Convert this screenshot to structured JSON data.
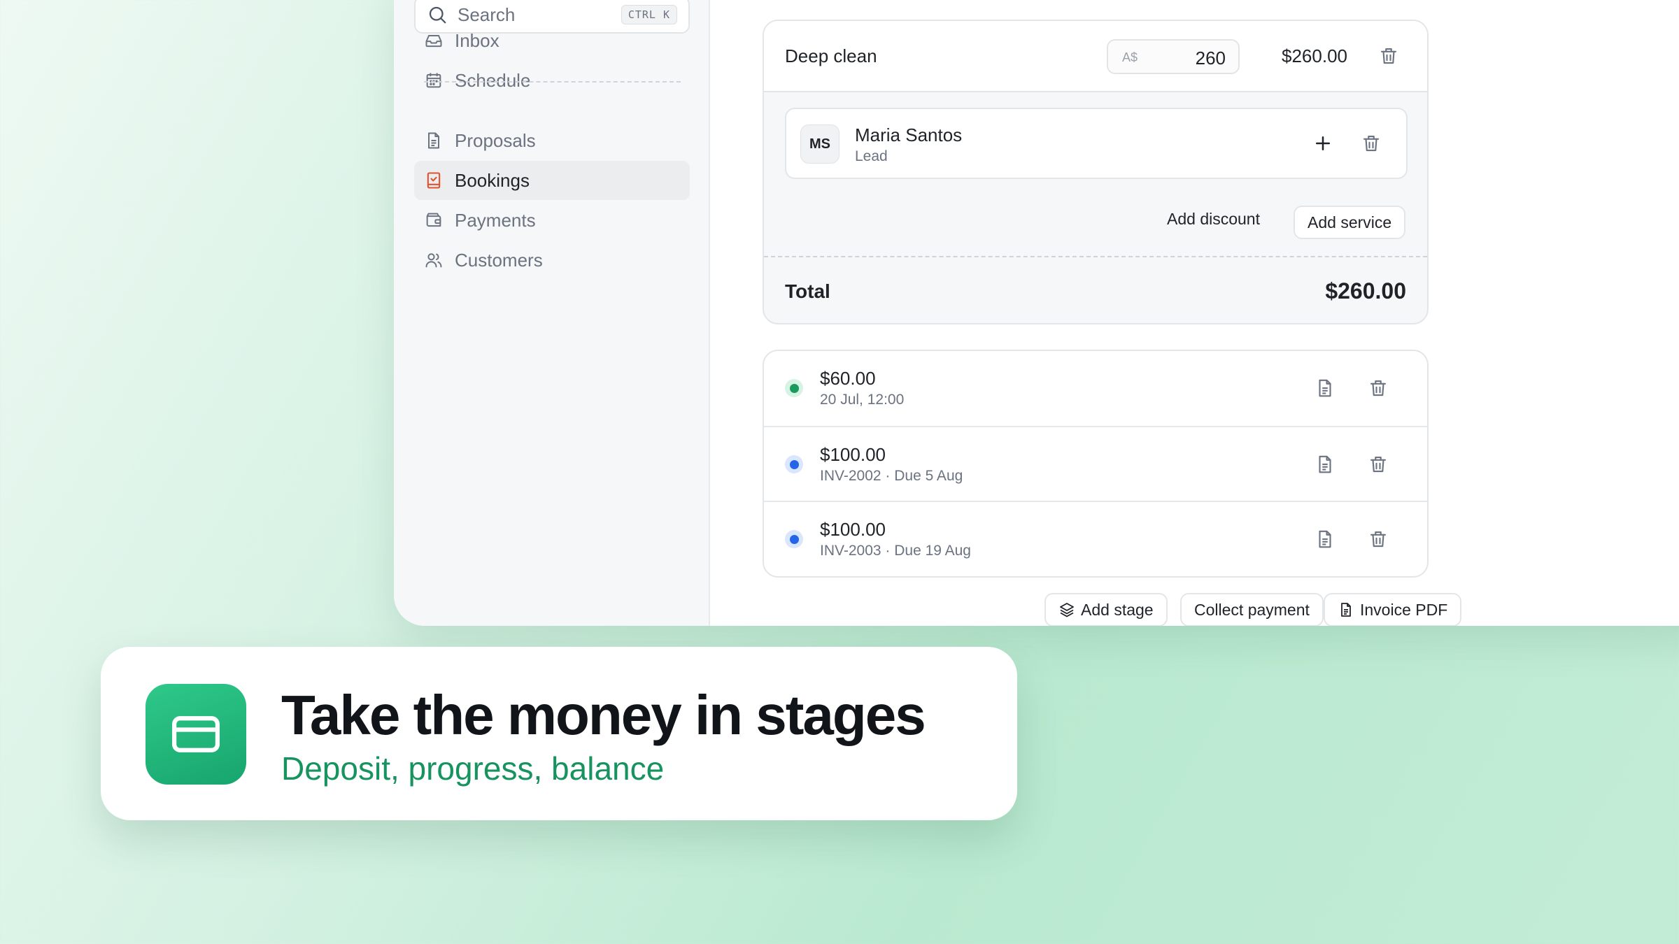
{
  "sidebar": {
    "search": {
      "placeholder": "Search",
      "shortcut": "CTRL K"
    },
    "items": [
      {
        "label": "Inbox",
        "icon": "inbox-icon",
        "active": false
      },
      {
        "label": "Schedule",
        "icon": "calendar-icon",
        "active": false
      },
      {
        "label": "Proposals",
        "icon": "document-icon",
        "active": false
      },
      {
        "label": "Bookings",
        "icon": "booking-check-icon",
        "active": true
      },
      {
        "label": "Payments",
        "icon": "wallet-icon",
        "active": false
      },
      {
        "label": "Customers",
        "icon": "users-icon",
        "active": false
      }
    ]
  },
  "service": {
    "name": "Deep clean",
    "currency": "A$",
    "price_input": "260",
    "line_total": "$260.00",
    "staff": {
      "initials": "MS",
      "name": "Maria Santos",
      "role": "Lead"
    },
    "add_discount_label": "Add discount",
    "add_service_label": "Add service",
    "total_label": "Total",
    "total_value": "$260.00"
  },
  "payments": [
    {
      "amount": "$60.00",
      "meta": "20 Jul, 12:00",
      "status": "paid",
      "color": "#1a9a5c",
      "ring": "#d6f3e3"
    },
    {
      "amount": "$100.00",
      "meta": "INV-2002 · Due 5 Aug",
      "status": "pending",
      "color": "#2566e8",
      "ring": "#d9e6fd"
    },
    {
      "amount": "$100.00",
      "meta": "INV-2003 · Due 19 Aug",
      "status": "pending",
      "color": "#2566e8",
      "ring": "#d9e6fd"
    }
  ],
  "bottom_actions": {
    "add_stage": "Add stage",
    "collect_payment": "Collect payment",
    "invoice_pdf": "Invoice PDF"
  },
  "callout": {
    "title": "Take the money in stages",
    "subtitle": "Deposit, progress, balance",
    "icon": "credit-card-icon",
    "accent": "#16935f"
  }
}
